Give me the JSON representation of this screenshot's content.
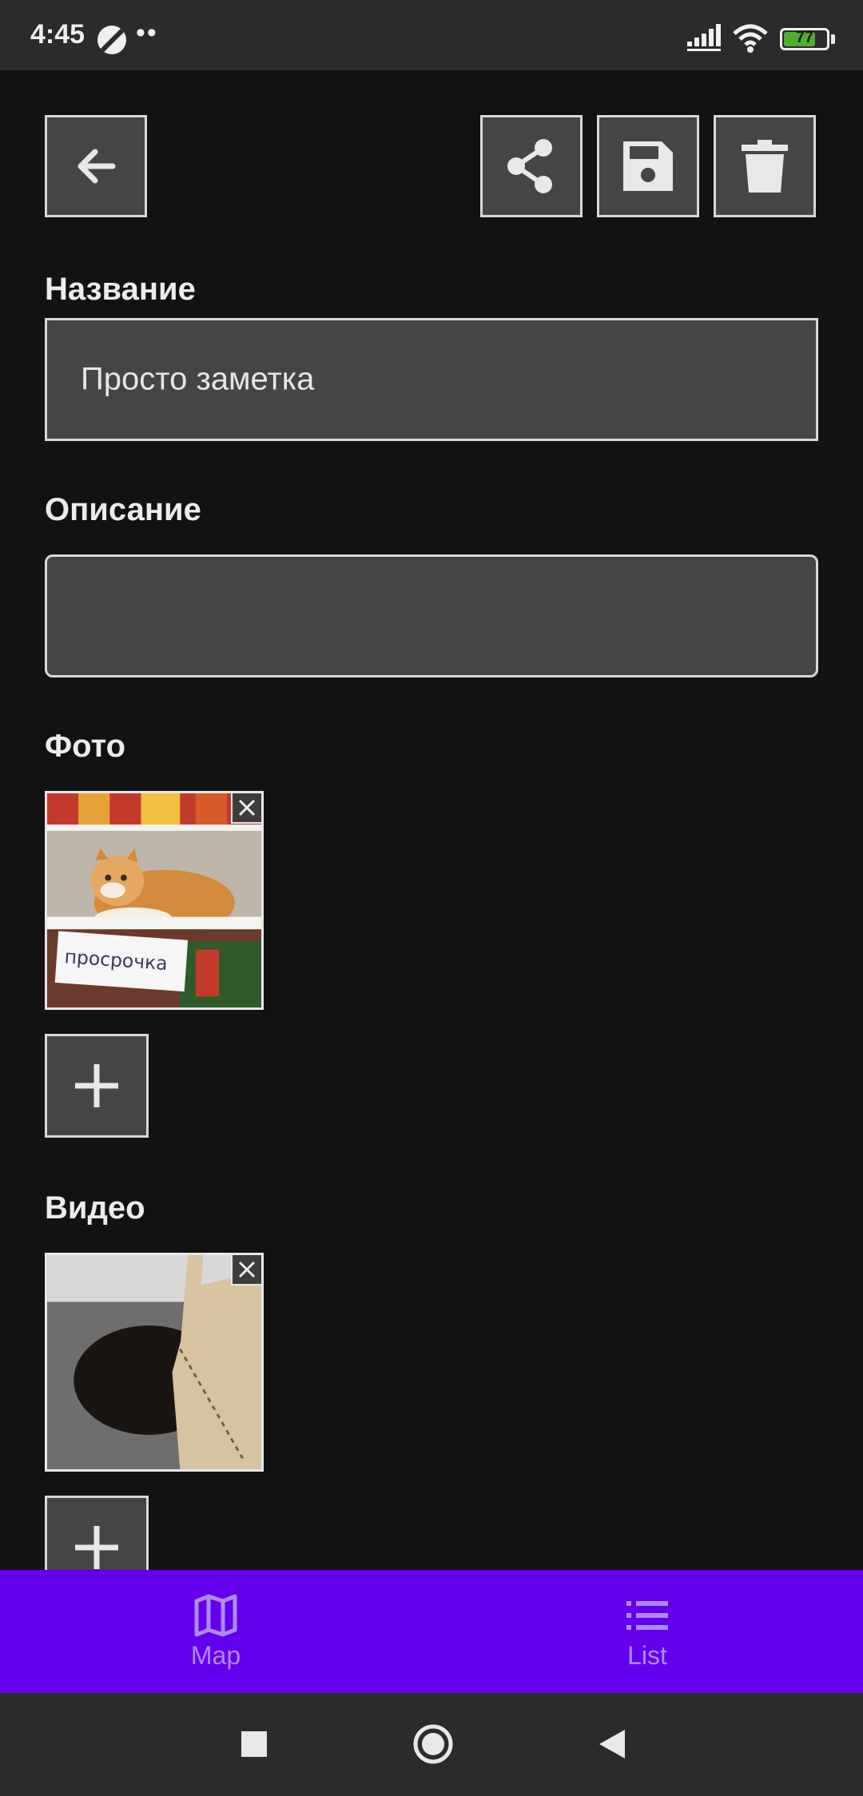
{
  "status_bar": {
    "time": "4:45",
    "dots": "••",
    "battery_level": "77",
    "battery_fraction": 0.77
  },
  "toolbar": {
    "back_icon": "arrow-left-icon",
    "share_icon": "share-icon",
    "save_icon": "floppy-disk-icon",
    "delete_icon": "trash-icon"
  },
  "form": {
    "title_label": "Название",
    "title_value": "Просто заметка",
    "description_label": "Описание",
    "description_value": "",
    "photo_label": "Фото",
    "video_label": "Видео",
    "photo_caption": "просрочка"
  },
  "tabs": [
    {
      "label": "Map",
      "icon": "map-icon"
    },
    {
      "label": "List",
      "icon": "list-icon"
    }
  ],
  "colors": {
    "background": "#121212",
    "button_fill": "#454545",
    "accent": "#6200ee",
    "tab_text": "#b08af0"
  }
}
